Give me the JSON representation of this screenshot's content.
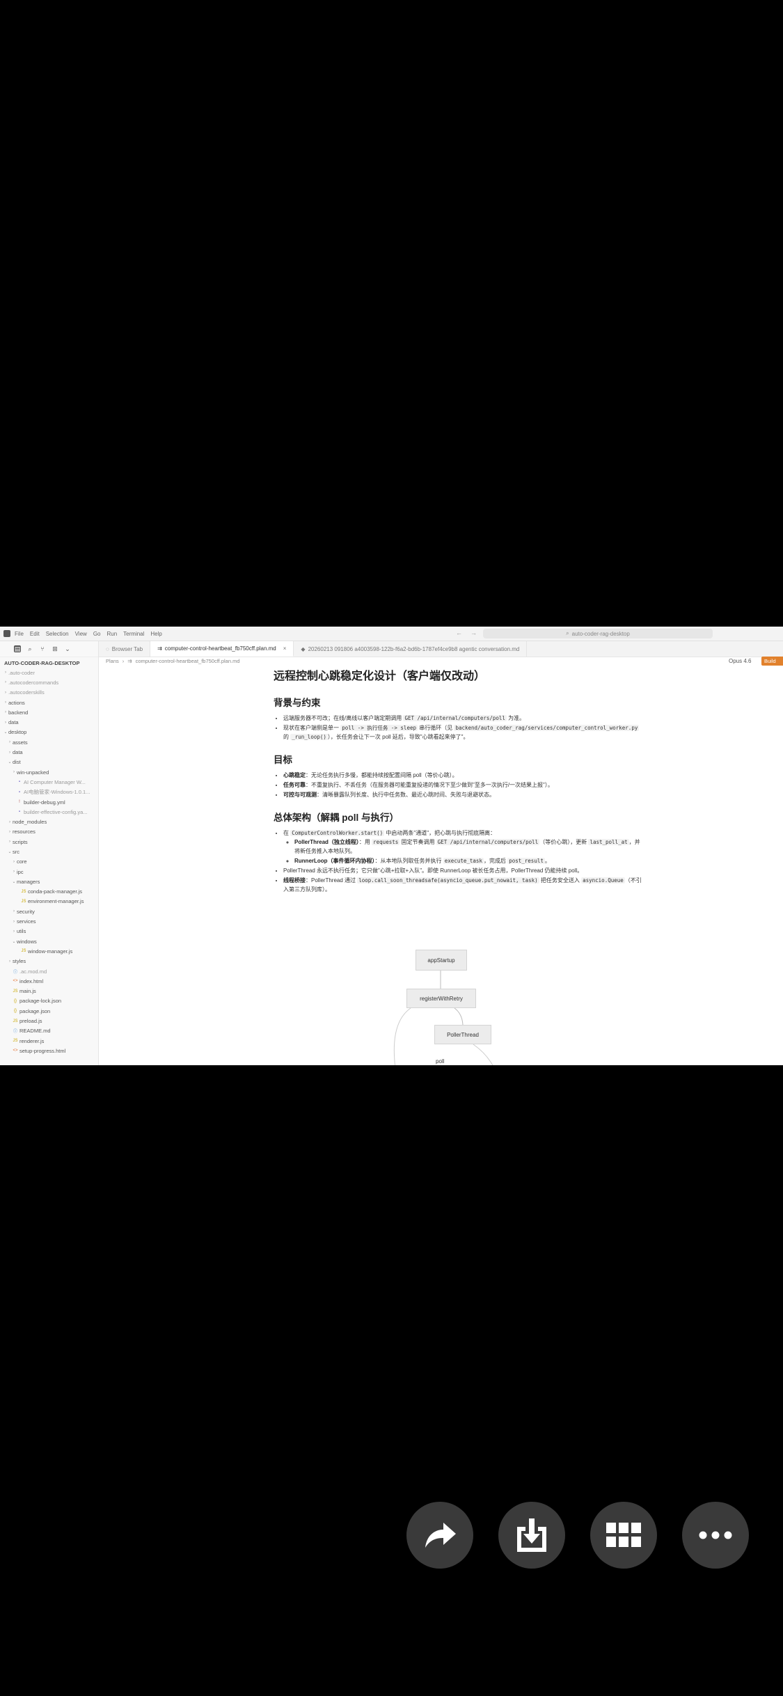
{
  "window": {
    "menu": [
      "File",
      "Edit",
      "Selection",
      "View",
      "Go",
      "Run",
      "Terminal",
      "Help"
    ],
    "search_text": "auto-coder-rag-desktop"
  },
  "sidebar": {
    "title": "AUTO-CODER-RAG-DESKTOP",
    "items": [
      {
        "label": ".auto-coder",
        "depth": 0,
        "type": "folder",
        "open": false
      },
      {
        "label": ".autocodercommands",
        "depth": 0,
        "type": "folder",
        "open": false
      },
      {
        "label": ".autocoderskills",
        "depth": 0,
        "type": "folder",
        "open": false
      },
      {
        "label": "actions",
        "depth": 0,
        "type": "folder",
        "open": false
      },
      {
        "label": "backend",
        "depth": 0,
        "type": "folder",
        "open": false
      },
      {
        "label": "data",
        "depth": 0,
        "type": "folder",
        "open": false
      },
      {
        "label": "desktop",
        "depth": 0,
        "type": "folder",
        "open": true
      },
      {
        "label": "assets",
        "depth": 1,
        "type": "folder",
        "open": false
      },
      {
        "label": "data",
        "depth": 1,
        "type": "folder",
        "open": false
      },
      {
        "label": "dist",
        "depth": 1,
        "type": "folder",
        "open": true
      },
      {
        "label": "win-unpacked",
        "depth": 2,
        "type": "folder",
        "open": false
      },
      {
        "label": "AI Computer Manager W...",
        "depth": 2,
        "type": "file",
        "open": false
      },
      {
        "label": "AI电脑管家-Windows-1.0.1...",
        "depth": 2,
        "type": "file",
        "open": false
      },
      {
        "label": "builder-debug.yml",
        "depth": 2,
        "type": "file",
        "open": false
      },
      {
        "label": "builder-effective-config.ya...",
        "depth": 2,
        "type": "file",
        "open": false
      },
      {
        "label": "node_modules",
        "depth": 1,
        "type": "folder",
        "open": false
      },
      {
        "label": "resources",
        "depth": 1,
        "type": "folder",
        "open": false
      },
      {
        "label": "scripts",
        "depth": 1,
        "type": "folder",
        "open": false
      },
      {
        "label": "src",
        "depth": 1,
        "type": "folder",
        "open": true
      },
      {
        "label": "core",
        "depth": 2,
        "type": "folder",
        "open": false
      },
      {
        "label": "ipc",
        "depth": 2,
        "type": "folder",
        "open": false
      },
      {
        "label": "managers",
        "depth": 2,
        "type": "folder",
        "open": true
      },
      {
        "label": "conda-pack-manager.js",
        "depth": 3,
        "type": "file",
        "open": false
      },
      {
        "label": "environment-manager.js",
        "depth": 3,
        "type": "file",
        "open": false
      },
      {
        "label": "security",
        "depth": 2,
        "type": "folder",
        "open": false
      },
      {
        "label": "services",
        "depth": 2,
        "type": "folder",
        "open": false
      },
      {
        "label": "utils",
        "depth": 2,
        "type": "folder",
        "open": false
      },
      {
        "label": "windows",
        "depth": 2,
        "type": "folder",
        "open": true
      },
      {
        "label": "window-manager.js",
        "depth": 3,
        "type": "file",
        "open": false
      },
      {
        "label": "styles",
        "depth": 1,
        "type": "folder",
        "open": false
      },
      {
        "label": ".ac.mod.md",
        "depth": 1,
        "type": "file",
        "open": false
      },
      {
        "label": "index.html",
        "depth": 1,
        "type": "file",
        "open": false
      },
      {
        "label": "main.js",
        "depth": 1,
        "type": "file",
        "open": false
      },
      {
        "label": "package-lock.json",
        "depth": 1,
        "type": "file",
        "open": false
      },
      {
        "label": "package.json",
        "depth": 1,
        "type": "file",
        "open": false
      },
      {
        "label": "preload.js",
        "depth": 1,
        "type": "file",
        "open": false
      },
      {
        "label": "README.md",
        "depth": 1,
        "type": "file",
        "open": false
      },
      {
        "label": "renderer.js",
        "depth": 1,
        "type": "file",
        "open": false
      },
      {
        "label": "setup-progress.html",
        "depth": 1,
        "type": "file",
        "open": false
      }
    ]
  },
  "tabs": [
    {
      "label": "Browser Tab",
      "active": false
    },
    {
      "label": "computer-control-heartbeat_fb750cff.plan.md",
      "active": true
    },
    {
      "label": "20260213 091806 a4003598-122b-f6a2-bd6b-1787ef4ce9b8 agentic conversation.md",
      "active": false
    }
  ],
  "breadcrumb": [
    "Plans",
    "computer-control-heartbeat_fb750cff.plan.md"
  ],
  "model": "Opus 4.6",
  "build_label": "Build",
  "doc": {
    "title": "远程控制心跳稳定化设计（客户端仅改动）",
    "s1_title": "背景与约束",
    "s1_b1_a": "远端服务器不可改；在线/离线以客户端定期调用 ",
    "s1_b1_code": "GET /api/internal/computers/poll",
    "s1_b1_b": " 为准。",
    "s1_b2_a": "现状在客户端侧是单一 ",
    "s1_b2_code1": "poll -> 执行任务 -> sleep",
    "s1_b2_b": " 串行循环（见 ",
    "s1_b2_code2": "backend/auto_coder_rag/services/computer_control_worker.py",
    "s1_b2_c": " 的 ",
    "s1_b2_code3": "_run_loop()",
    "s1_b2_d": "），长任务会让下一次 poll 延后，导致\"心跳看起来停了\"。",
    "s2_title": "目标",
    "s2_b1_bold": "心跳稳定",
    "s2_b1_text": "：无论任务执行多慢，都能持续按配置间隔 poll（等价心跳）。",
    "s2_b2_bold": "任务可靠",
    "s2_b2_text": "：不重复执行、不丢任务（在服务器可能重复投递的情况下至少做到\"至多一次执行/一次结果上报\"）。",
    "s2_b3_bold": "可控与可观测",
    "s2_b3_text": "：清晰暴露队列长度、执行中任务数、最近心跳时间、失败与退避状态。",
    "s3_title": "总体架构（解耦 poll 与执行）",
    "s3_b1_a": "在 ",
    "s3_b1_code": "ComputerControlWorker.start()",
    "s3_b1_b": " 中启动两条\"通道\"，把心跳与执行彻底隔离：",
    "s3_sub1_bold": "PollerThread（独立线程）",
    "s3_sub1_a": "：用 ",
    "s3_sub1_code1": "requests",
    "s3_sub1_b": " 固定节奏调用 ",
    "s3_sub1_code2": "GET /api/internal/computers/poll",
    "s3_sub1_c": "（等价心跳），更新 ",
    "s3_sub1_code3": "last_poll_at",
    "s3_sub1_d": "，并将新任务推入本地队列。",
    "s3_sub2_bold": "RunnerLoop（事件循环内协程）",
    "s3_sub2_a": "：从本地队列取任务并执行 ",
    "s3_sub2_code1": "execute_task",
    "s3_sub2_b": "，完成后 ",
    "s3_sub2_code2": "post_result",
    "s3_sub2_c": "。",
    "s3_b2": "PollerThread 永远不执行任务；它只做\"心跳+拉取+入队\"。即使 RunnerLoop 被长任务占用，PollerThread 仍能持续 poll。",
    "s3_b3_bold": "线程桥接",
    "s3_b3_a": "：PollerThread 通过 ",
    "s3_b3_code1": "loop.call_soon_threadsafe(asyncio_queue.put_nowait, task)",
    "s3_b3_b": " 把任务安全送入 ",
    "s3_b3_code2": "asyncio.Queue",
    "s3_b3_c": "（不引入第三方队列库）。"
  },
  "diagram": {
    "nodes": [
      "appStartup",
      "registerWithRetry",
      "PollerThread"
    ],
    "edge_label": "poll"
  },
  "actions": [
    {
      "name": "share-button",
      "icon": "share-icon"
    },
    {
      "name": "download-button",
      "icon": "download-icon"
    },
    {
      "name": "apps-button",
      "icon": "grid-icon"
    },
    {
      "name": "more-button",
      "icon": "more-icon"
    }
  ]
}
